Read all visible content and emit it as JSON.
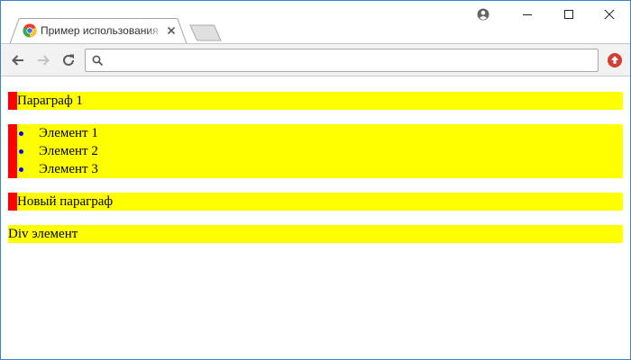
{
  "browser": {
    "tab": {
      "title": "Пример использования"
    },
    "omnibox": {
      "value": "",
      "placeholder": ""
    },
    "icons": {
      "favicon": "chrome-favicon",
      "tab_close": "close-icon",
      "new_tab": "new-tab-icon",
      "profile": "profile-icon",
      "minimize": "minimize-icon",
      "maximize": "maximize-icon",
      "close_window": "close-icon",
      "back": "arrow-left-icon",
      "forward": "arrow-right-icon",
      "reload": "reload-icon",
      "search": "search-icon",
      "extension": "upload-icon"
    }
  },
  "page": {
    "paragraph_1": "Параграф 1",
    "list_items": [
      "Элемент 1",
      "Элемент 2",
      "Элемент 3"
    ],
    "paragraph_2": "Новый параграф",
    "div_text": "Div элемент"
  },
  "colors": {
    "block_background": "#ffff00",
    "marker": "#ff0000",
    "bullet": "#0000ff",
    "window_border": "#3c82c8"
  }
}
